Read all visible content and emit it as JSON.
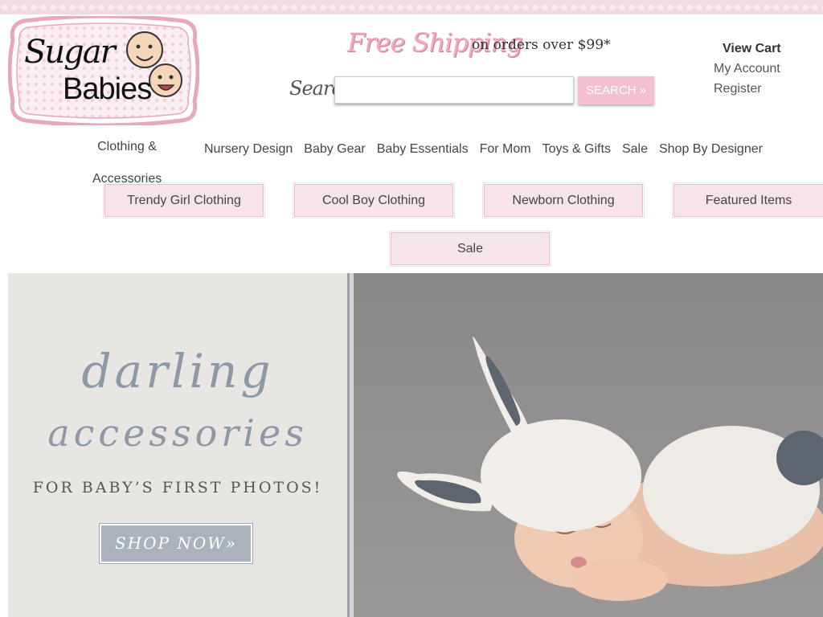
{
  "brand": {
    "name_line1": "Sugar",
    "name_line2": "Babies"
  },
  "promo": {
    "script": "Free Shipping",
    "rest": "on orders over $99*"
  },
  "search": {
    "label": "Search",
    "value": "",
    "placeholder": "",
    "button_label": "SEARCH »"
  },
  "account": {
    "view_cart": "View Cart",
    "my_account": "My Account",
    "register": "Register"
  },
  "nav": {
    "items": [
      "Clothing & Accessories",
      "Nursery Design",
      "Baby Gear",
      "Baby Essentials",
      "For Mom",
      "Toys & Gifts",
      "Sale",
      "Shop By Designer"
    ]
  },
  "subnav": {
    "items": [
      "Trendy Girl Clothing",
      "Cool Boy Clothing",
      "Newborn Clothing",
      "Featured Items",
      "Sale"
    ]
  },
  "hero": {
    "headline_line1": "darling",
    "headline_line2": "accessories",
    "subline": "FOR BABY’S FIRST PHOTOS!",
    "cta": "SHOP NOW»"
  },
  "colors": {
    "accent_pink": "#f4bfcf",
    "subnav_bg": "#f7e4ea",
    "hero_text": "#8f98a6"
  }
}
